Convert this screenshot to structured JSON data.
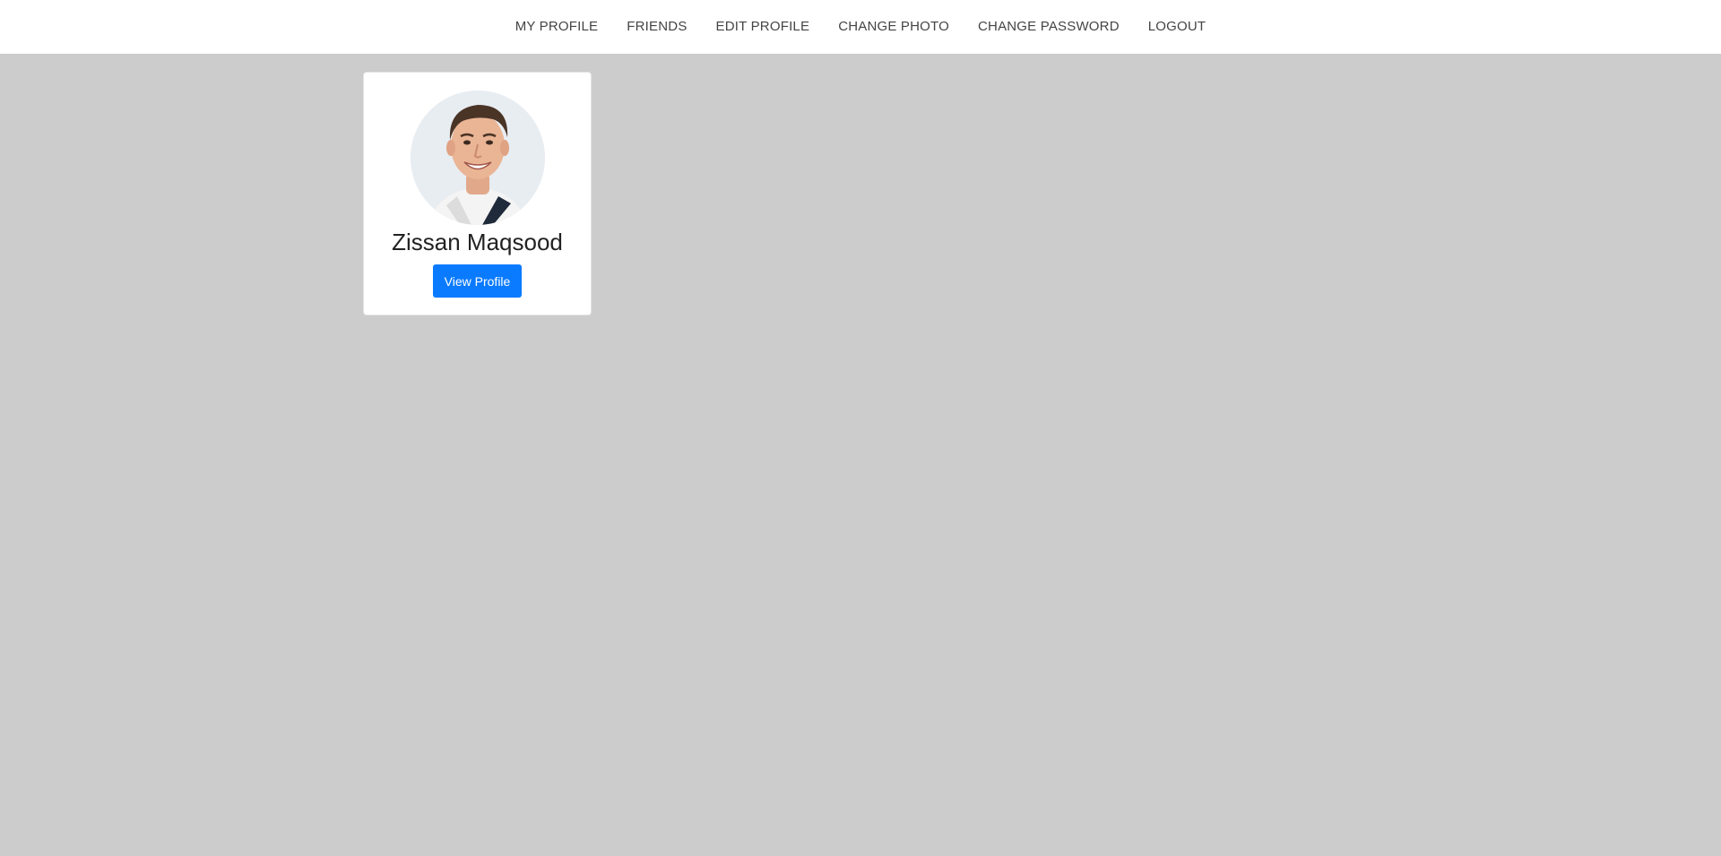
{
  "nav": {
    "items": [
      {
        "label": "MY PROFILE"
      },
      {
        "label": "FRIENDS"
      },
      {
        "label": "EDIT PROFILE"
      },
      {
        "label": "CHANGE PHOTO"
      },
      {
        "label": "CHANGE PASSWORD"
      },
      {
        "label": "LOGOUT"
      }
    ]
  },
  "card": {
    "name": "Zissan Maqsood",
    "button_label": "View Profile",
    "avatar_icon": "person-photo"
  },
  "colors": {
    "background": "#cccccc",
    "navbar": "#ffffff",
    "accent": "#0a7bff"
  }
}
